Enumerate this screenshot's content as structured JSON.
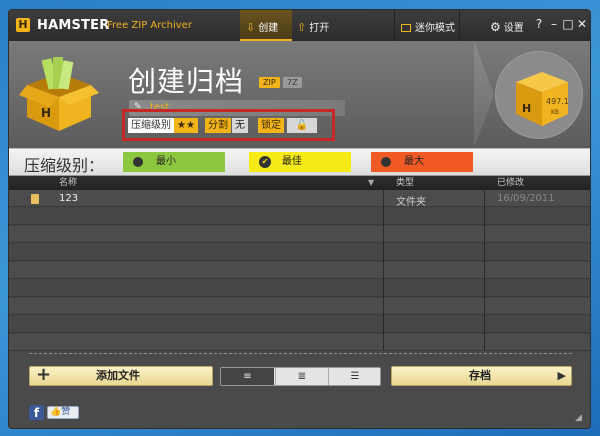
{
  "app": {
    "brand": "HAMSTER",
    "brand_sub": "Free ZIP Archiver",
    "logo_letter": "H"
  },
  "tabs": {
    "create": "创建",
    "open": "打开",
    "mini": "迷你模式",
    "settings": "设置"
  },
  "window_controls": {
    "help": "?",
    "minimize": "–",
    "maximize": "□",
    "close": "✕"
  },
  "header": {
    "title": "创建归档",
    "format_zip": "ZIP",
    "format_7z": "7Z",
    "archive_name": "test",
    "options": {
      "compression_label": "压缩级别",
      "compression_value": "★★",
      "split_label": "分割",
      "split_value": "无",
      "lock_label": "锁定"
    },
    "box_size": "497.1",
    "box_unit": "KB"
  },
  "compression": {
    "title": "压缩级别：",
    "levels": [
      {
        "label": "最小",
        "color": "#8dc63f"
      },
      {
        "label": "最佳",
        "color": "#f6eb16"
      },
      {
        "label": "最大",
        "color": "#f15a24"
      }
    ]
  },
  "list": {
    "columns": {
      "name": "名称",
      "type": "类型",
      "modified": "已修改"
    },
    "rows": [
      {
        "name": "123",
        "type": "文件夹",
        "modified": "16/09/2011"
      }
    ]
  },
  "bottom": {
    "add_files": "添加文件",
    "save": "存档",
    "view_icons": [
      "≡",
      "≣",
      "☰"
    ]
  },
  "social": {
    "facebook": "f",
    "like": "赞"
  },
  "colors": {
    "accent": "#f3b418",
    "highlight_frame": "#c62828"
  }
}
